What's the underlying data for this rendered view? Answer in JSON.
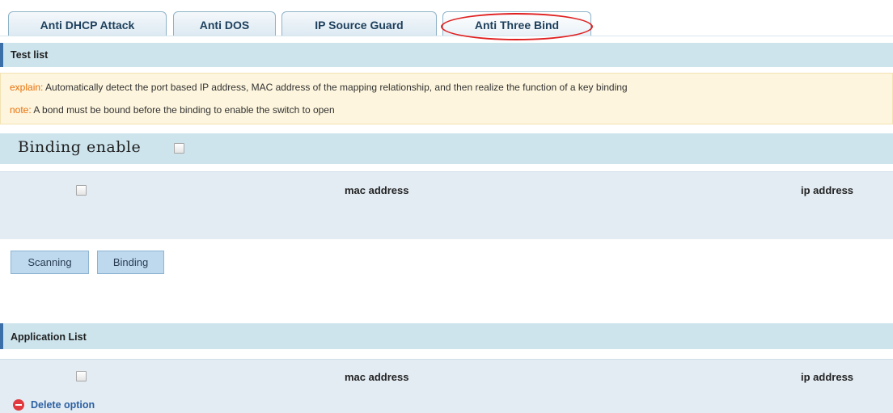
{
  "tabs": [
    {
      "label": "Anti DHCP Attack"
    },
    {
      "label": "Anti DOS"
    },
    {
      "label": "IP Source Guard"
    },
    {
      "label": "Anti Three Bind",
      "active": true
    }
  ],
  "test_list": {
    "title": "Test list"
  },
  "notice": {
    "explain_key": "explain:",
    "explain_text": " Automatically detect the port based IP address, MAC address of the mapping relationship, and then realize the function of a key binding",
    "note_key": "note:",
    "note_text": " A bond must be bound before the binding to enable the switch to open"
  },
  "binding": {
    "label": "Binding enable",
    "checked": false
  },
  "scan_table": {
    "columns": [
      "mac address",
      "ip address"
    ],
    "rows": []
  },
  "buttons": {
    "scanning": "Scanning",
    "binding": "Binding"
  },
  "application_list": {
    "title": "Application List",
    "columns": [
      "mac address",
      "ip address"
    ],
    "rows": []
  },
  "delete_option": {
    "label": "Delete option"
  },
  "colors": {
    "accent": "#3a6fa8",
    "header_bg": "#cde4ed",
    "highlight": "#e02020",
    "notice_key": "#e8700b",
    "delete_icon": "#e0393e"
  }
}
